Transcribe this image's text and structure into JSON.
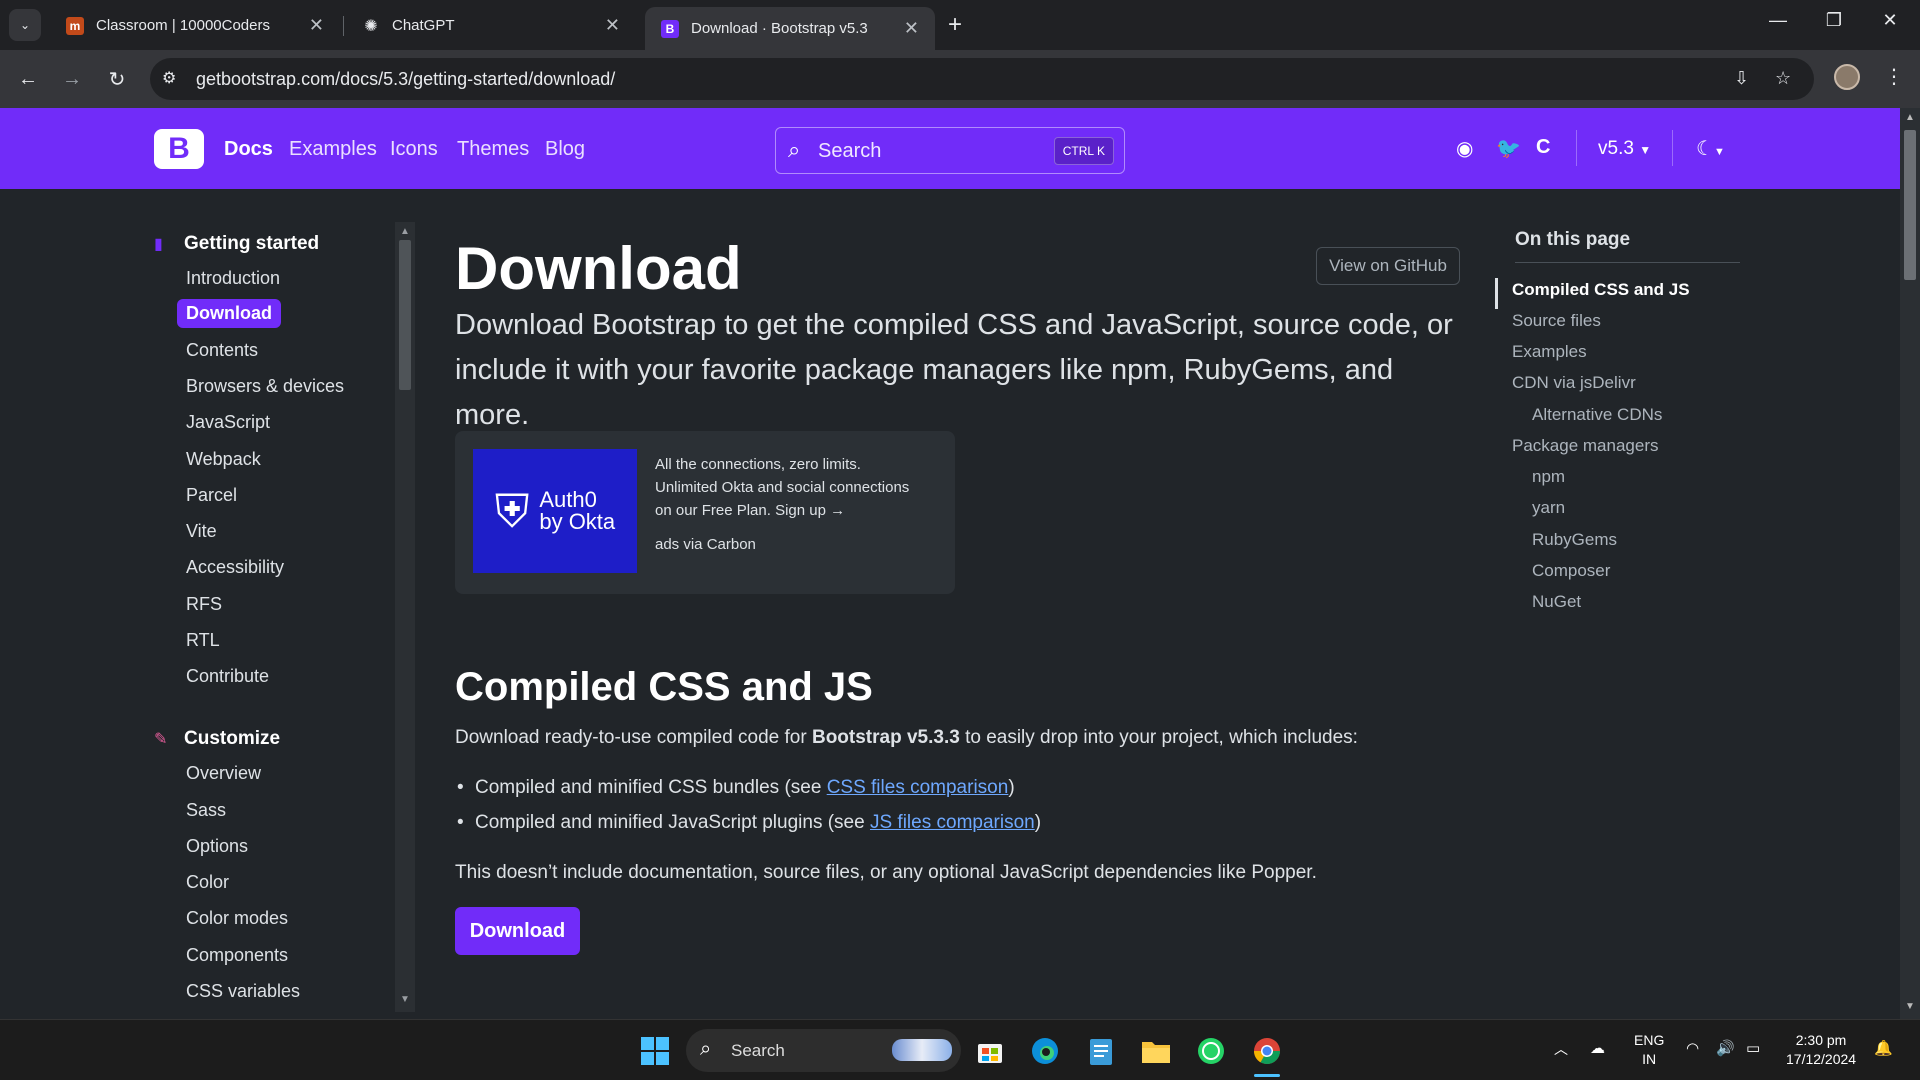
{
  "browser": {
    "tabs": [
      {
        "title": "Classroom | 10000Coders",
        "icon": "classroom-favicon"
      },
      {
        "title": "ChatGPT",
        "icon": "chatgpt-favicon"
      },
      {
        "title": "Download · Bootstrap v5.3",
        "icon": "bootstrap-favicon"
      }
    ],
    "url": "getbootstrap.com/docs/5.3/getting-started/download/"
  },
  "site": {
    "logo": "B",
    "nav": [
      "Docs",
      "Examples",
      "Icons",
      "Themes",
      "Blog"
    ],
    "search_placeholder": "Search",
    "search_shortcut": "CTRL K",
    "version": "v5.3",
    "brand_color": "#712cf9"
  },
  "sidebar": {
    "sections": [
      {
        "title": "Getting started",
        "items": [
          "Introduction",
          "Download",
          "Contents",
          "Browsers & devices",
          "JavaScript",
          "Webpack",
          "Parcel",
          "Vite",
          "Accessibility",
          "RFS",
          "RTL",
          "Contribute"
        ]
      },
      {
        "title": "Customize",
        "items": [
          "Overview",
          "Sass",
          "Options",
          "Color",
          "Color modes",
          "Components",
          "CSS variables"
        ]
      }
    ],
    "active_item": "Download"
  },
  "main": {
    "title": "Download",
    "github_button": "View on GitHub",
    "lead_line1": "Download Bootstrap to get the compiled CSS and JavaScript, source code, or",
    "lead_line2": "include it with your favorite package managers like npm, RubyGems, and more.",
    "ad": {
      "brand_line1": "Auth0",
      "brand_line2": "by Okta",
      "text_line1": "All the connections, zero limits.",
      "text_line2": "Unlimited Okta and social connections",
      "text_line3": "on our Free Plan. Sign up →",
      "via": "ads via Carbon"
    },
    "section_title": "Compiled CSS and JS",
    "intro_pre": "Download ready-to-use compiled code for ",
    "intro_bold": "Bootstrap v5.3.3",
    "intro_post": " to easily drop into your project, which includes:",
    "bullet1_pre": "Compiled and minified CSS bundles (see ",
    "bullet1_link": "CSS files comparison",
    "bullet1_post": ")",
    "bullet2_pre": "Compiled and minified JavaScript plugins (see ",
    "bullet2_link": "JS files comparison",
    "bullet2_post": ")",
    "note": "This doesn’t include documentation, source files, or any optional JavaScript dependencies like Popper.",
    "download_button": "Download"
  },
  "toc": {
    "heading": "On this page",
    "items": [
      "Compiled CSS and JS",
      "Source files",
      "Examples",
      "CDN via jsDelivr",
      "Alternative CDNs",
      "Package managers",
      "npm",
      "yarn",
      "RubyGems",
      "Composer",
      "NuGet"
    ]
  },
  "taskbar": {
    "search_placeholder": "Search",
    "lang_line1": "ENG",
    "lang_line2": "IN",
    "time": "2:30 pm",
    "date": "17/12/2024"
  }
}
